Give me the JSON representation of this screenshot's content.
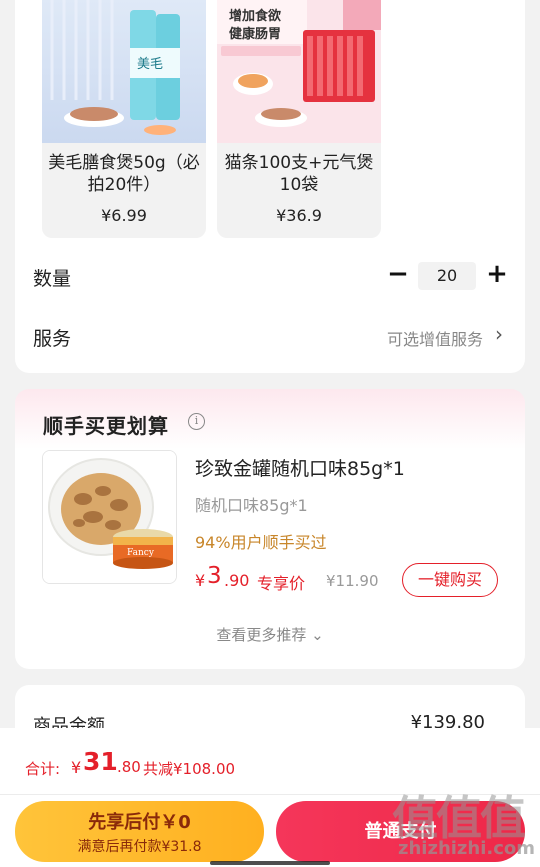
{
  "options": [
    {
      "name": "美毛膳食煲50g（必拍20件）",
      "price": "¥6.99",
      "image_text": "美毛"
    },
    {
      "name": "猫条100支+元气煲10袋",
      "price": "¥36.9",
      "image_text": "增加食欲\n健康肠胃"
    }
  ],
  "quantity": {
    "label": "数量",
    "value": "20",
    "minus": "−",
    "plus": "+"
  },
  "service": {
    "label": "服务",
    "hint": "可选增值服务",
    "arrow": "›"
  },
  "recommend": {
    "title": "顺手买更划算",
    "info_icon": "i",
    "product": {
      "name": "珍致金罐随机口味85g*1",
      "spec": "随机口味85g*1",
      "social": "94%用户顺手买过",
      "price_symbol": "¥",
      "price_int": "3",
      "price_dec": ".90",
      "price_tag": "专享价",
      "orig_price": "¥11.90",
      "buy_label": "一键购买"
    },
    "more": "查看更多推荐 ⌄"
  },
  "amount": {
    "label": "商品金额",
    "value": "¥139.80"
  },
  "summary": {
    "label": "合计:",
    "symbol": "¥",
    "int": "31",
    "dec": ".80",
    "discount": "共减¥108.00"
  },
  "buttons": {
    "later_title": "先享后付￥0",
    "later_sub": "满意后再付款¥31.8",
    "pay": "普通支付"
  },
  "watermark": {
    "chars": "值值值",
    "site": "zhizhizhi.com"
  },
  "colors": {
    "accent": "#e4202a",
    "pay_button": "#f0304f",
    "later_button": "#ffbb2e",
    "social_text": "#c8862a"
  }
}
